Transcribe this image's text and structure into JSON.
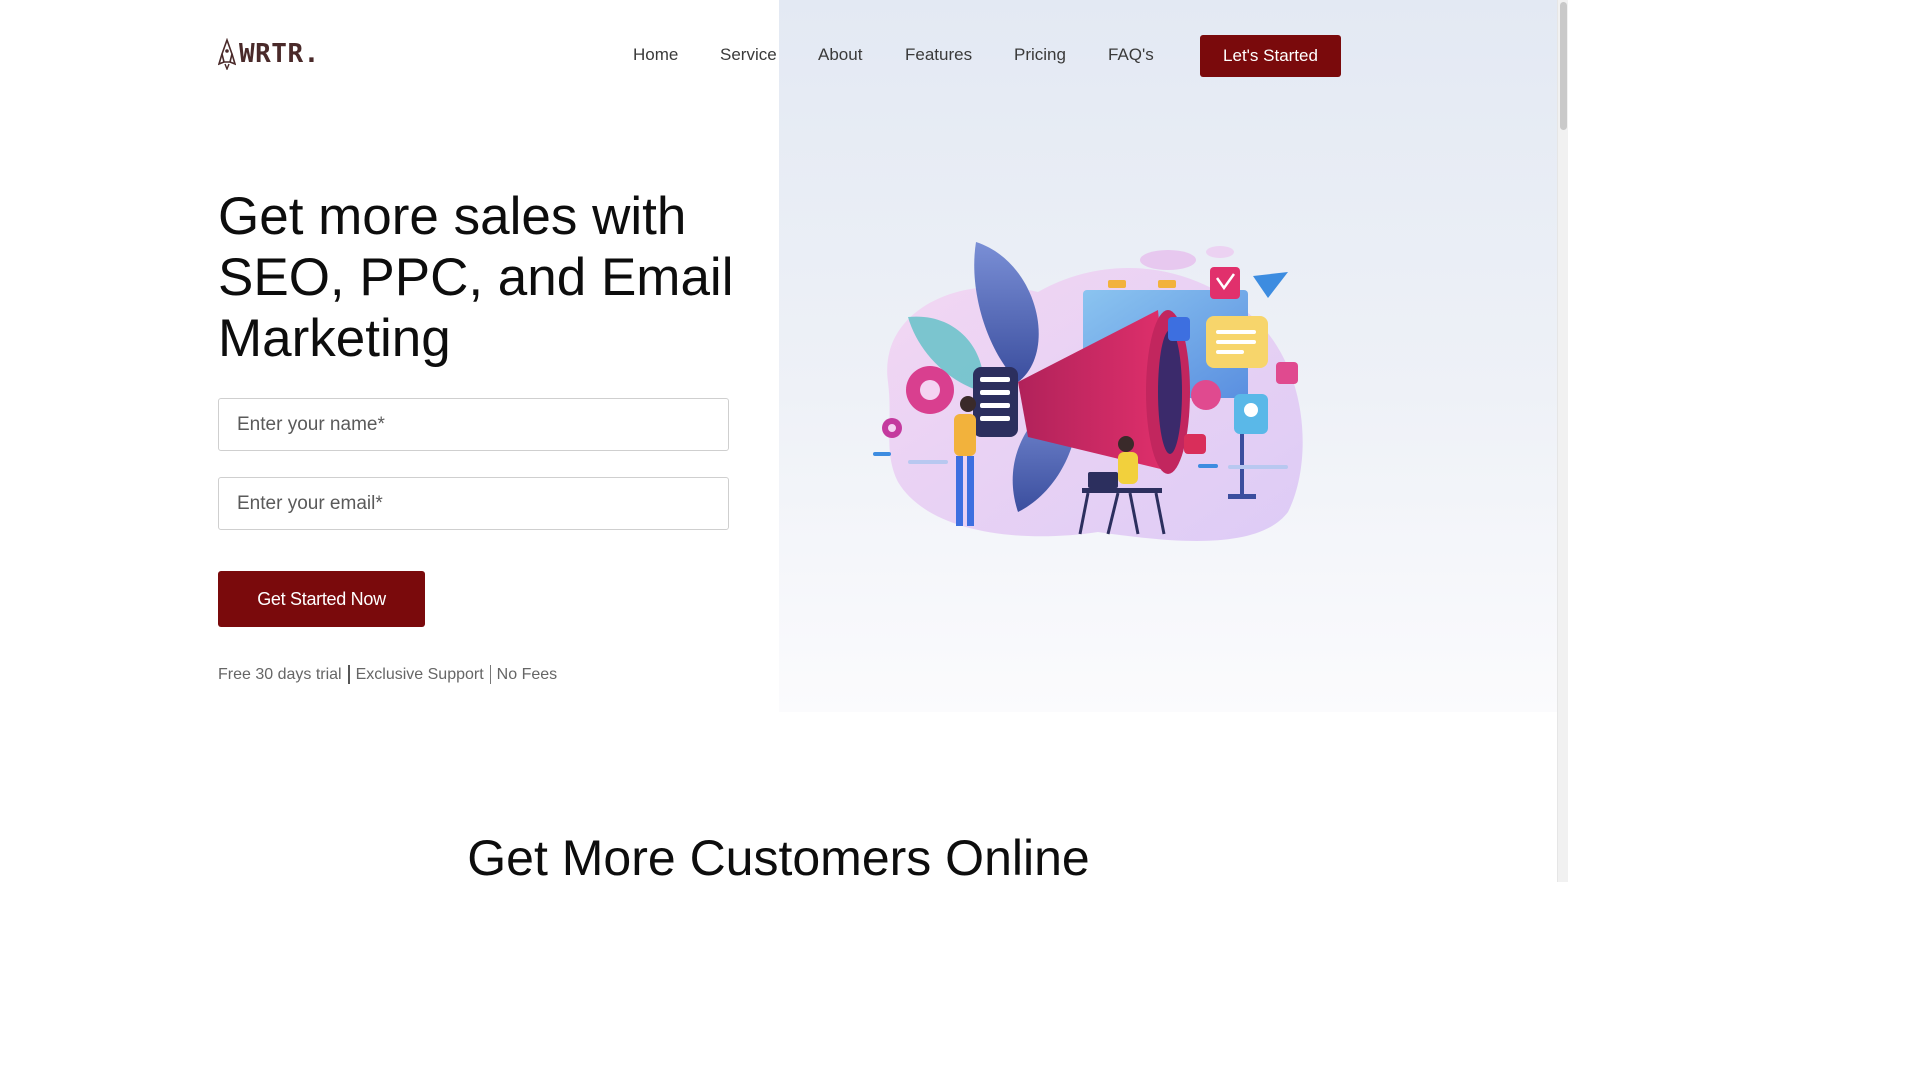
{
  "brand": {
    "name": "WRTR.",
    "logo_icon": "rocket-logo-icon",
    "logo_color": "#4a2a2a"
  },
  "nav": {
    "items": [
      "Home",
      "Service",
      "About",
      "Features",
      "Pricing",
      "FAQ's"
    ],
    "cta_label": "Let's Started"
  },
  "hero": {
    "title": "Get more sales with SEO, PPC, and Email Marketing",
    "name_placeholder": "Enter your name*",
    "email_placeholder": "Enter your email*",
    "cta_label": "Get Started Now",
    "perks": [
      "Free 30 days trial",
      "Exclusive Support",
      "No Fees"
    ],
    "illustration": "marketing-megaphone-illustration"
  },
  "section2": {
    "title": "Get More Customers Online"
  },
  "colors": {
    "accent": "#7a0a0c",
    "hero_panel": "#e3e9f3",
    "text": "#0d0d0d",
    "muted": "#666666"
  }
}
